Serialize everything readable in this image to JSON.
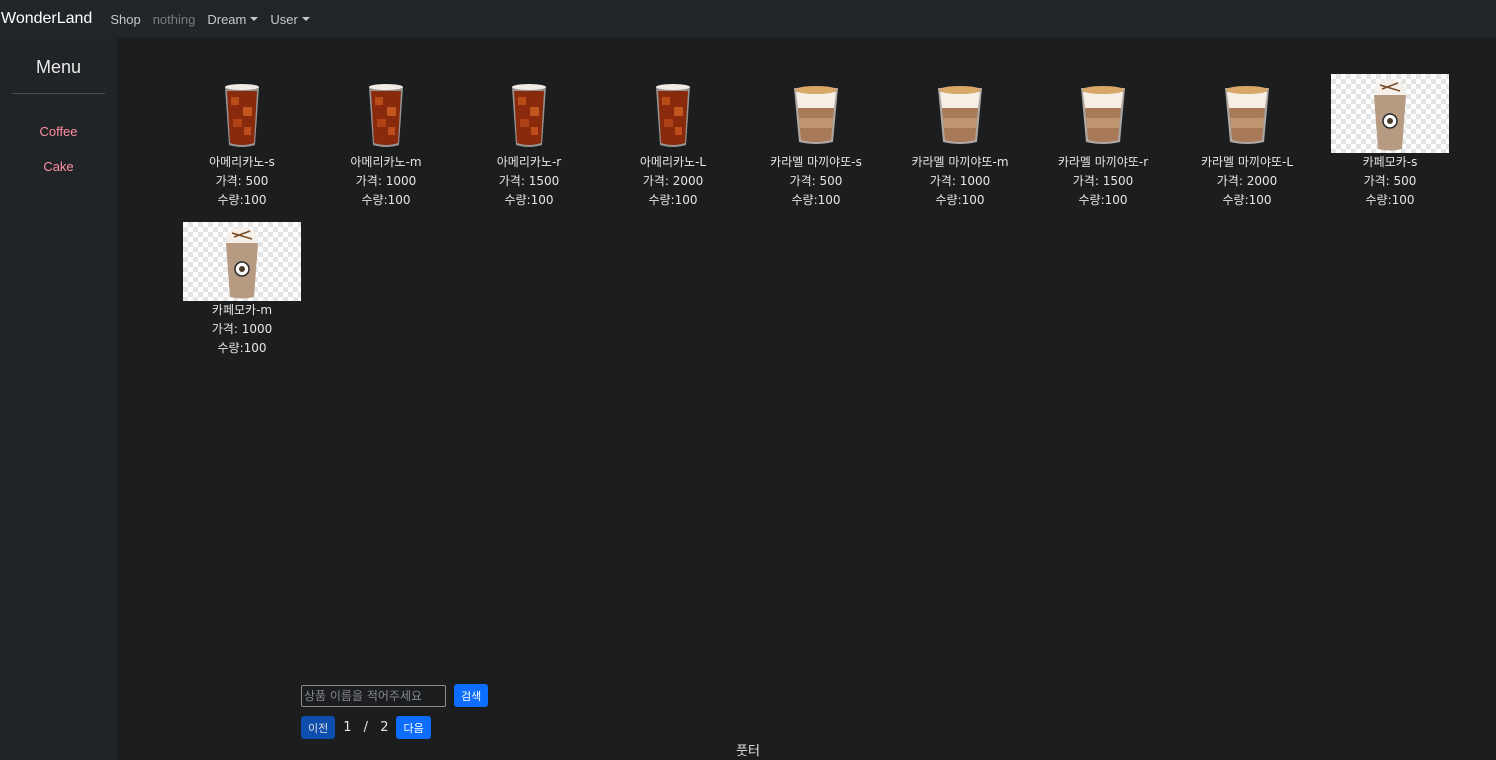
{
  "navbar": {
    "brand": "WonderLand",
    "items": [
      {
        "label": "Shop",
        "dropdown": false,
        "muted": false
      },
      {
        "label": "nothing",
        "dropdown": false,
        "muted": true
      },
      {
        "label": "Dream",
        "dropdown": true,
        "muted": false
      },
      {
        "label": "User",
        "dropdown": true,
        "muted": false
      }
    ]
  },
  "sidebar": {
    "title": "Menu",
    "links": [
      {
        "label": "Coffee"
      },
      {
        "label": "Cake"
      }
    ]
  },
  "products": [
    {
      "name": "아메리카노-s",
      "price": "가격: 500",
      "qty": "수량:100",
      "image": "iced-americano"
    },
    {
      "name": "아메리카노-m",
      "price": "가격: 1000",
      "qty": "수량:100",
      "image": "iced-americano"
    },
    {
      "name": "아메리카노-r",
      "price": "가격: 1500",
      "qty": "수량:100",
      "image": "iced-americano"
    },
    {
      "name": "아메리카노-L",
      "price": "가격: 2000",
      "qty": "수량:100",
      "image": "iced-americano"
    },
    {
      "name": "카라멜 마끼야또-s",
      "price": "가격: 500",
      "qty": "수량:100",
      "image": "caramel-macchiato"
    },
    {
      "name": "카라멜 마끼야또-m",
      "price": "가격: 1000",
      "qty": "수량:100",
      "image": "caramel-macchiato"
    },
    {
      "name": "카라멜 마끼야또-r",
      "price": "가격: 1500",
      "qty": "수량:100",
      "image": "caramel-macchiato"
    },
    {
      "name": "카라멜 마끼야또-L",
      "price": "가격: 2000",
      "qty": "수량:100",
      "image": "caramel-macchiato"
    },
    {
      "name": "카페모카-s",
      "price": "가격: 500",
      "qty": "수량:100",
      "image": "cafe-mocha"
    },
    {
      "name": "카페모카-m",
      "price": "가격: 1000",
      "qty": "수량:100",
      "image": "cafe-mocha"
    }
  ],
  "search": {
    "placeholder": "상품 이름을 적어주세요",
    "button_label": "검색"
  },
  "pagination": {
    "prev_label": "이전",
    "current": "1",
    "separator": "/",
    "total": "2",
    "next_label": "다음"
  },
  "footer": {
    "text": "풋터"
  },
  "colors": {
    "background": "#1b1d1f",
    "navbar": "#212529",
    "sidebar_link": "#ff8fa3",
    "primary_button": "#0d6efd"
  }
}
